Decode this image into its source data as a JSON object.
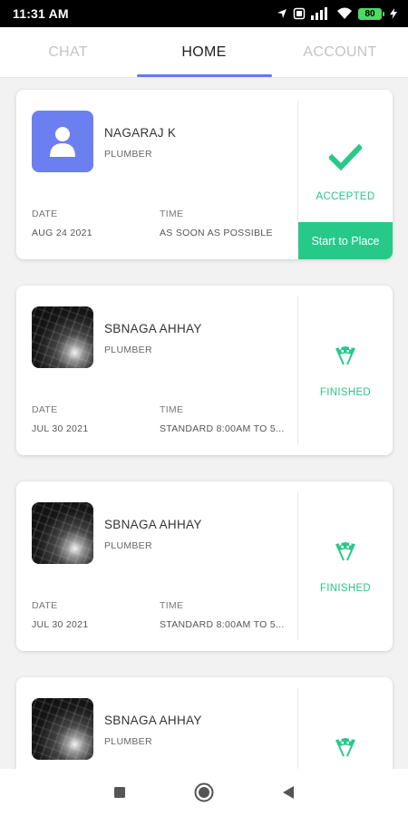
{
  "status_bar": {
    "time": "11:31 AM",
    "battery": "80"
  },
  "tabs": [
    {
      "label": "CHAT",
      "active": false
    },
    {
      "label": "HOME",
      "active": true
    },
    {
      "label": "ACCOUNT",
      "active": false
    }
  ],
  "labels": {
    "date": "DATE",
    "time": "TIME"
  },
  "bookings": [
    {
      "name": "NAGARAJ K",
      "role": "PLUMBER",
      "date": "AUG 24 2021",
      "time": "AS SOON AS POSSIBLE",
      "status": "ACCEPTED",
      "status_icon": "check-icon",
      "avatar": "user-placeholder",
      "action_label": "Start to Place"
    },
    {
      "name": "SBNAGA AHHAY",
      "role": "PLUMBER",
      "date": "JUL 30 2021",
      "time": "STANDARD 8:00AM  TO 5...",
      "status": "FINISHED",
      "status_icon": "finish-flags-icon",
      "avatar": "keyboard-photo"
    },
    {
      "name": "SBNAGA AHHAY",
      "role": "PLUMBER",
      "date": "JUL 30 2021",
      "time": "STANDARD 8:00AM  TO 5...",
      "status": "FINISHED",
      "status_icon": "finish-flags-icon",
      "avatar": "keyboard-photo"
    },
    {
      "name": "SBNAGA AHHAY",
      "role": "PLUMBER",
      "status_icon": "finish-flags-icon",
      "avatar": "keyboard-photo"
    }
  ],
  "colors": {
    "accent": "#6779ec",
    "success": "#27c989",
    "avatar_bg": "#6c7ff0"
  }
}
